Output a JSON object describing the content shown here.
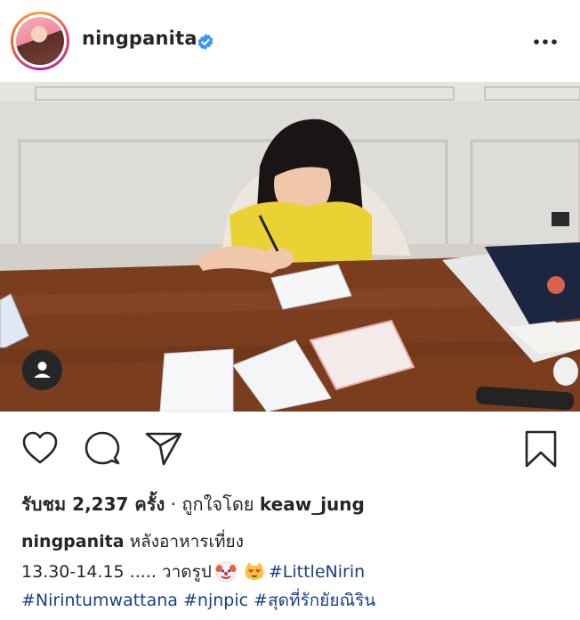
{
  "header": {
    "username": "ningpanita",
    "verified_icon": "verified-badge-icon",
    "more_icon": "more-options-icon"
  },
  "photo": {
    "description_icon": "post-photo",
    "tag_icon": "user-tag-icon"
  },
  "actions": {
    "like_icon": "heart-icon",
    "comment_icon": "comment-icon",
    "share_icon": "send-icon",
    "save_icon": "bookmark-icon"
  },
  "likes": {
    "prefix": "รับชม ",
    "count": "2,237",
    "suffix": " ครั้ง",
    "separator": " · ถูกใจโดย ",
    "liked_by": "keaw_jung"
  },
  "caption": {
    "username": "ningpanita",
    "text": " หลังอาหารเที่ยง",
    "line2_text": "13.30-14.15 ..... วาดรูป",
    "emoji1": "clown-emoji",
    "emoji2": "heart-eyes-cat-emoji",
    "hashtag1": "#LittleNirin",
    "line3": "#Nirintumwattana #njnpic #สุดที่รักยัยณิริน"
  },
  "colors": {
    "hashtag": "#1a3f86",
    "verified": "#3897f0",
    "text": "#262626"
  }
}
